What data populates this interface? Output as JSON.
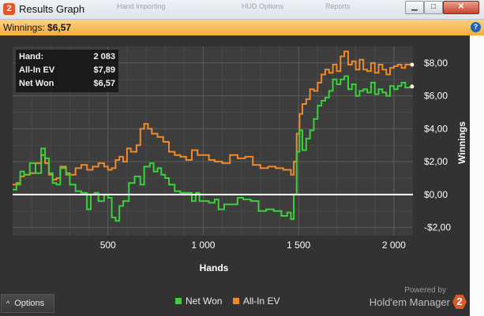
{
  "window": {
    "title": "Results Graph",
    "logo_text": "2",
    "buttons": {
      "minimize": "▁",
      "maximize": "□",
      "close": "✕"
    }
  },
  "background_menu": [
    "Hand Importing",
    "HUD Options",
    "Reports"
  ],
  "infobar": {
    "label": "Winnings:",
    "value": "$6,57",
    "help_icon": "?"
  },
  "stats": [
    {
      "key": "Hand:",
      "value": "2 083"
    },
    {
      "key": "All-In EV",
      "value": "$7,89"
    },
    {
      "key": "Net Won",
      "value": "$6,57"
    }
  ],
  "bottom": {
    "options_label": "Options",
    "options_icon": "^",
    "powered_by": "Powered by",
    "brand": "Hold'em Manager",
    "brand_logo": "2"
  },
  "chart_data": {
    "type": "line",
    "xlabel": "Hands",
    "ylabel": "Winnings",
    "xlim": [
      0,
      2100
    ],
    "ylim": [
      -2.5,
      9
    ],
    "x_ticks": [
      500,
      1000,
      1500,
      2000
    ],
    "x_tick_labels": [
      "500",
      "1 000",
      "1 500",
      "2 000"
    ],
    "y_ticks": [
      -2,
      0,
      2,
      4,
      6,
      8
    ],
    "y_tick_labels": [
      "-$2,00",
      "$0,00",
      "$2,00",
      "$4,00",
      "$6,00",
      "$8,00"
    ],
    "grid": true,
    "legend_position": "bottom-center",
    "series": [
      {
        "name": "Net Won",
        "color": "#3bd13b",
        "points": [
          [
            0,
            0.3
          ],
          [
            20,
            0.6
          ],
          [
            40,
            1.4
          ],
          [
            60,
            1.2
          ],
          [
            90,
            1.9
          ],
          [
            120,
            1.3
          ],
          [
            150,
            2.8
          ],
          [
            170,
            2.2
          ],
          [
            190,
            1.3
          ],
          [
            210,
            0.7
          ],
          [
            230,
            0.6
          ],
          [
            250,
            1.6
          ],
          [
            280,
            1.2
          ],
          [
            300,
            0.6
          ],
          [
            330,
            0.2
          ],
          [
            360,
            0.1
          ],
          [
            390,
            -0.9
          ],
          [
            410,
            0.0
          ],
          [
            430,
            0.1
          ],
          [
            450,
            -0.4
          ],
          [
            480,
            0.0
          ],
          [
            500,
            -0.2
          ],
          [
            520,
            -1.4
          ],
          [
            540,
            -1.6
          ],
          [
            560,
            -0.7
          ],
          [
            580,
            -0.4
          ],
          [
            610,
            0.7
          ],
          [
            640,
            1.1
          ],
          [
            670,
            0.6
          ],
          [
            690,
            1.7
          ],
          [
            720,
            1.9
          ],
          [
            740,
            1.4
          ],
          [
            760,
            1.6
          ],
          [
            780,
            1.2
          ],
          [
            800,
            1.0
          ],
          [
            820,
            0.6
          ],
          [
            850,
            0.2
          ],
          [
            880,
            0.1
          ],
          [
            910,
            0.1
          ],
          [
            940,
            -0.4
          ],
          [
            960,
            0.1
          ],
          [
            980,
            -0.4
          ],
          [
            1000,
            -0.4
          ],
          [
            1030,
            -0.5
          ],
          [
            1060,
            -0.3
          ],
          [
            1080,
            -0.9
          ],
          [
            1110,
            -0.6
          ],
          [
            1140,
            -0.6
          ],
          [
            1180,
            -0.2
          ],
          [
            1210,
            -0.3
          ],
          [
            1250,
            -0.4
          ],
          [
            1290,
            -1.0
          ],
          [
            1330,
            -0.9
          ],
          [
            1370,
            -1.0
          ],
          [
            1410,
            -1.3
          ],
          [
            1440,
            -1.1
          ],
          [
            1460,
            -1.5
          ],
          [
            1475,
            0.0
          ],
          [
            1490,
            2.6
          ],
          [
            1505,
            3.9
          ],
          [
            1520,
            2.7
          ],
          [
            1540,
            3.4
          ],
          [
            1560,
            3.9
          ],
          [
            1580,
            4.6
          ],
          [
            1600,
            5.4
          ],
          [
            1620,
            5.7
          ],
          [
            1640,
            5.9
          ],
          [
            1660,
            6.3
          ],
          [
            1680,
            7.0
          ],
          [
            1700,
            6.7
          ],
          [
            1720,
            7.0
          ],
          [
            1740,
            7.2
          ],
          [
            1760,
            6.4
          ],
          [
            1780,
            6.7
          ],
          [
            1800,
            6.0
          ],
          [
            1820,
            6.3
          ],
          [
            1840,
            6.4
          ],
          [
            1860,
            6.2
          ],
          [
            1880,
            6.8
          ],
          [
            1900,
            6.1
          ],
          [
            1920,
            6.4
          ],
          [
            1940,
            6.2
          ],
          [
            1960,
            6.0
          ],
          [
            1980,
            6.6
          ],
          [
            2000,
            6.4
          ],
          [
            2020,
            6.6
          ],
          [
            2040,
            6.8
          ],
          [
            2060,
            6.5
          ],
          [
            2083,
            6.57
          ]
        ]
      },
      {
        "name": "All-In EV",
        "color": "#f0892a",
        "points": [
          [
            0,
            0.6
          ],
          [
            20,
            0.7
          ],
          [
            40,
            1.1
          ],
          [
            60,
            1.2
          ],
          [
            90,
            1.3
          ],
          [
            120,
            1.9
          ],
          [
            150,
            2.4
          ],
          [
            170,
            1.9
          ],
          [
            190,
            1.2
          ],
          [
            210,
            0.9
          ],
          [
            230,
            1.0
          ],
          [
            250,
            1.7
          ],
          [
            280,
            1.3
          ],
          [
            300,
            1.2
          ],
          [
            330,
            1.6
          ],
          [
            360,
            1.8
          ],
          [
            390,
            1.5
          ],
          [
            420,
            1.7
          ],
          [
            450,
            1.9
          ],
          [
            480,
            1.7
          ],
          [
            500,
            1.5
          ],
          [
            520,
            1.6
          ],
          [
            540,
            2.1
          ],
          [
            560,
            2.3
          ],
          [
            580,
            2.0
          ],
          [
            600,
            2.8
          ],
          [
            620,
            2.6
          ],
          [
            650,
            3.0
          ],
          [
            670,
            4.0
          ],
          [
            690,
            4.3
          ],
          [
            710,
            4.0
          ],
          [
            730,
            3.7
          ],
          [
            760,
            3.5
          ],
          [
            790,
            3.2
          ],
          [
            820,
            2.6
          ],
          [
            850,
            2.4
          ],
          [
            880,
            2.3
          ],
          [
            910,
            2.1
          ],
          [
            940,
            2.7
          ],
          [
            970,
            2.4
          ],
          [
            1000,
            2.4
          ],
          [
            1030,
            2.1
          ],
          [
            1060,
            2.0
          ],
          [
            1100,
            1.9
          ],
          [
            1140,
            2.4
          ],
          [
            1180,
            2.2
          ],
          [
            1220,
            2.3
          ],
          [
            1260,
            1.8
          ],
          [
            1300,
            1.6
          ],
          [
            1340,
            1.7
          ],
          [
            1380,
            1.6
          ],
          [
            1420,
            1.5
          ],
          [
            1460,
            1.2
          ],
          [
            1475,
            2.0
          ],
          [
            1490,
            3.7
          ],
          [
            1505,
            4.9
          ],
          [
            1520,
            5.5
          ],
          [
            1540,
            5.8
          ],
          [
            1560,
            6.4
          ],
          [
            1580,
            6.3
          ],
          [
            1600,
            6.8
          ],
          [
            1620,
            7.3
          ],
          [
            1640,
            7.6
          ],
          [
            1660,
            7.4
          ],
          [
            1680,
            7.9
          ],
          [
            1700,
            7.5
          ],
          [
            1720,
            8.4
          ],
          [
            1740,
            8.7
          ],
          [
            1760,
            7.9
          ],
          [
            1780,
            8.1
          ],
          [
            1800,
            7.6
          ],
          [
            1820,
            8.2
          ],
          [
            1840,
            7.6
          ],
          [
            1860,
            7.5
          ],
          [
            1880,
            8.0
          ],
          [
            1900,
            7.4
          ],
          [
            1920,
            7.9
          ],
          [
            1940,
            7.6
          ],
          [
            1960,
            7.3
          ],
          [
            1980,
            7.7
          ],
          [
            2000,
            7.8
          ],
          [
            2020,
            7.9
          ],
          [
            2040,
            7.7
          ],
          [
            2060,
            7.9
          ],
          [
            2083,
            7.89
          ]
        ]
      }
    ]
  }
}
